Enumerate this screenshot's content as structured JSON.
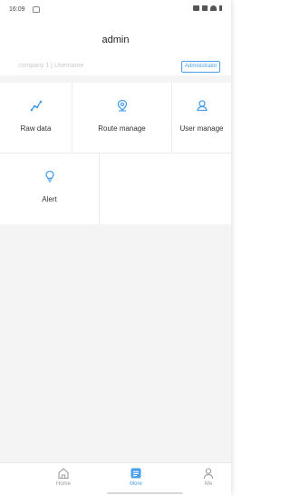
{
  "status_bar": {
    "time": "16:09"
  },
  "header": {
    "title": "admin",
    "subtitle": "company 1 | Username",
    "role_badge": "Administrator"
  },
  "menu": {
    "items": [
      {
        "label": "Raw data",
        "icon": "raw-data-icon"
      },
      {
        "label": "Route manage",
        "icon": "route-pin-icon"
      },
      {
        "label": "User manage",
        "icon": "user-manage-icon"
      },
      {
        "label": "Alert",
        "icon": "alert-bulb-icon"
      }
    ]
  },
  "tabbar": {
    "tabs": [
      {
        "label": "Home",
        "icon": "home-icon",
        "active": false
      },
      {
        "label": "More",
        "icon": "more-icon",
        "active": true
      },
      {
        "label": "Me",
        "icon": "person-icon",
        "active": false
      }
    ]
  },
  "colors": {
    "accent": "#4a9fe8",
    "background": "#f4f4f4",
    "text": "#333333"
  }
}
